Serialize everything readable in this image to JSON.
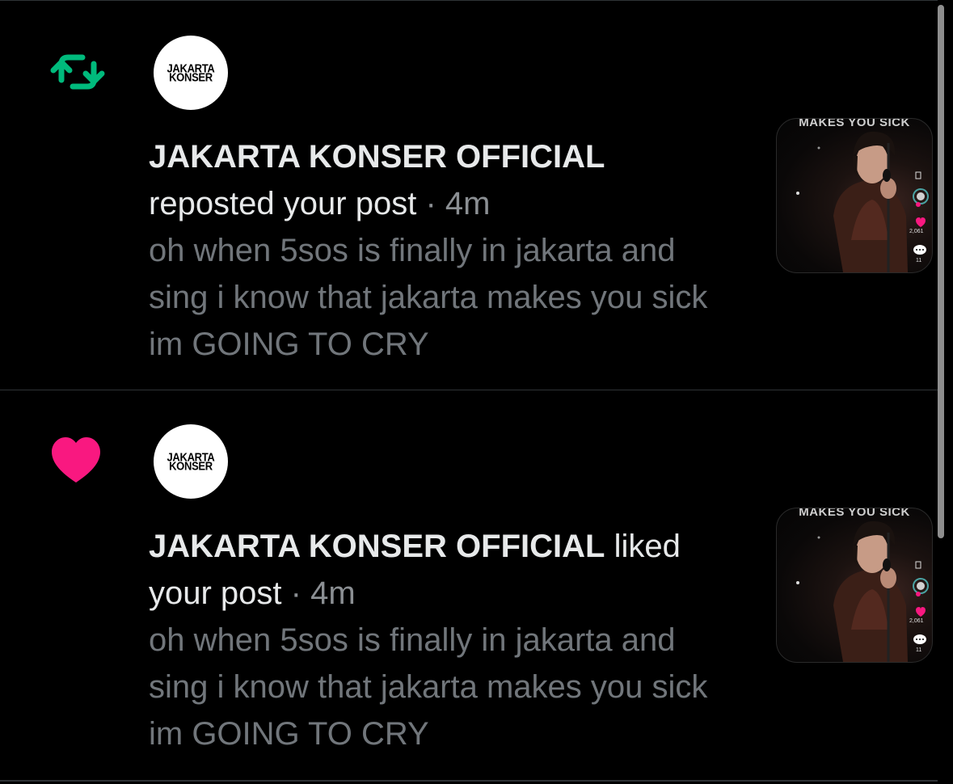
{
  "notifications": [
    {
      "type": "repost",
      "icon": "repost-icon",
      "icon_color": "#00ba7c",
      "avatar": {
        "line1": "JAKARTA",
        "line2": "KONSER"
      },
      "user_name": "JAKARTA KONSER OFFICIAL",
      "action_text": "reposted your post",
      "separator": "·",
      "time": "4m",
      "post_text": "oh when 5sos is finally in jakarta and sing i know that jakarta makes you sick im GOING TO CRY",
      "thumbnail": {
        "caption": "MAKES YOU SICK",
        "like_count": "2,061",
        "comment_count": "11"
      }
    },
    {
      "type": "like",
      "icon": "heart-icon",
      "icon_color": "#f91880",
      "avatar": {
        "line1": "JAKARTA",
        "line2": "KONSER"
      },
      "user_name": "JAKARTA KONSER OFFICIAL",
      "action_text": "liked your post",
      "separator": "·",
      "time": "4m",
      "post_text": "oh when 5sos is finally in jakarta and sing i know that jakarta makes you sick im GOING TO CRY",
      "thumbnail": {
        "caption": "MAKES YOU SICK",
        "like_count": "2,061",
        "comment_count": "11"
      }
    }
  ],
  "colors": {
    "background": "#000000",
    "primary_text": "#e7e9ea",
    "secondary_text": "#71767b",
    "divider": "#2f3336",
    "repost_green": "#00ba7c",
    "like_pink": "#f91880"
  }
}
